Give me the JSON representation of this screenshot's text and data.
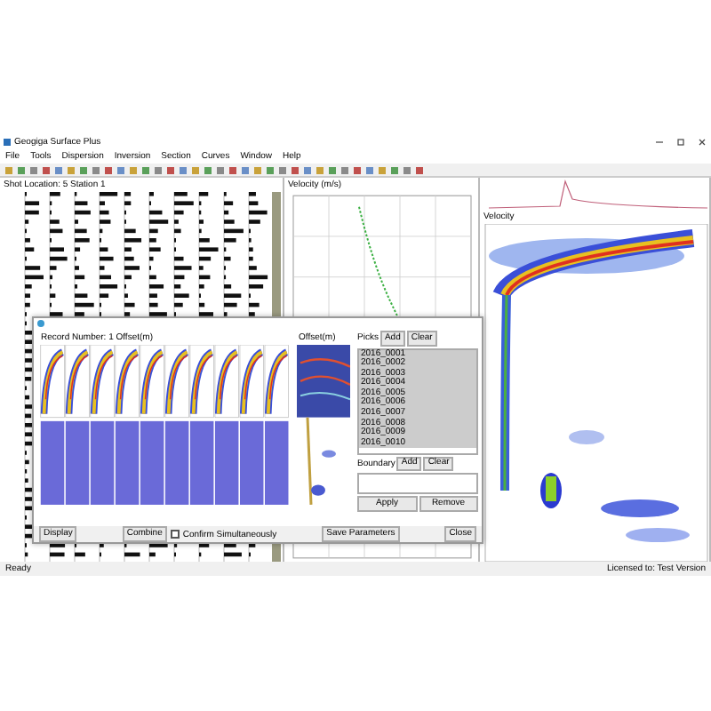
{
  "window": {
    "title": "Geogiga Surface Plus"
  },
  "menu": [
    "File",
    "Tools",
    "Dispersion",
    "Inversion",
    "Section",
    "Curves",
    "Window",
    "Help"
  ],
  "shots_panel": {
    "title": "Shot Location: 5 Station 1"
  },
  "velocity_panel": {
    "title": "Velocity (m/s)"
  },
  "spectrum_panel": {
    "title": "Velocity"
  },
  "dialog": {
    "title": "Record Number: 1 Offset(m)",
    "side_title": "Offset(m)",
    "list_header": [
      "Picks",
      "Add",
      "Clear"
    ],
    "list": [
      {
        "label": "2016_0001",
        "selected": true
      },
      {
        "label": "2016_0002",
        "selected": true
      },
      {
        "label": "2016_0003",
        "selected": true
      },
      {
        "label": "2016_0004",
        "selected": true
      },
      {
        "label": "2016_0005",
        "selected": true
      },
      {
        "label": "2016_0006",
        "selected": true
      },
      {
        "label": "2016_0007",
        "selected": true
      },
      {
        "label": "2016_0008",
        "selected": true
      },
      {
        "label": "2016_0009",
        "selected": true
      },
      {
        "label": "2016_0010",
        "selected": true
      }
    ],
    "boundary_buttons": [
      "Boundary",
      "Add",
      "Clear"
    ],
    "apply_buttons": [
      "Apply",
      "Remove"
    ],
    "bottom": {
      "display": "Display",
      "combine": "Combine",
      "confirm": "Confirm Simultaneously",
      "confirm_checked": false,
      "save": "Save Parameters",
      "close": "Close"
    }
  },
  "status_bar": {
    "left": "Ready",
    "right": "Licensed to: Test Version"
  }
}
